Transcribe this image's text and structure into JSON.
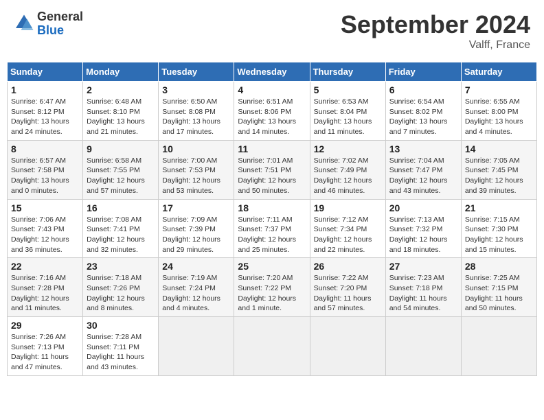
{
  "header": {
    "logo_general": "General",
    "logo_blue": "Blue",
    "month_title": "September 2024",
    "location": "Valff, France"
  },
  "weekdays": [
    "Sunday",
    "Monday",
    "Tuesday",
    "Wednesday",
    "Thursday",
    "Friday",
    "Saturday"
  ],
  "weeks": [
    [
      {
        "day": "1",
        "sunrise": "6:47 AM",
        "sunset": "8:12 PM",
        "daylight": "13 hours and 24 minutes."
      },
      {
        "day": "2",
        "sunrise": "6:48 AM",
        "sunset": "8:10 PM",
        "daylight": "13 hours and 21 minutes."
      },
      {
        "day": "3",
        "sunrise": "6:50 AM",
        "sunset": "8:08 PM",
        "daylight": "13 hours and 17 minutes."
      },
      {
        "day": "4",
        "sunrise": "6:51 AM",
        "sunset": "8:06 PM",
        "daylight": "13 hours and 14 minutes."
      },
      {
        "day": "5",
        "sunrise": "6:53 AM",
        "sunset": "8:04 PM",
        "daylight": "13 hours and 11 minutes."
      },
      {
        "day": "6",
        "sunrise": "6:54 AM",
        "sunset": "8:02 PM",
        "daylight": "13 hours and 7 minutes."
      },
      {
        "day": "7",
        "sunrise": "6:55 AM",
        "sunset": "8:00 PM",
        "daylight": "13 hours and 4 minutes."
      }
    ],
    [
      {
        "day": "8",
        "sunrise": "6:57 AM",
        "sunset": "7:58 PM",
        "daylight": "13 hours and 0 minutes."
      },
      {
        "day": "9",
        "sunrise": "6:58 AM",
        "sunset": "7:55 PM",
        "daylight": "12 hours and 57 minutes."
      },
      {
        "day": "10",
        "sunrise": "7:00 AM",
        "sunset": "7:53 PM",
        "daylight": "12 hours and 53 minutes."
      },
      {
        "day": "11",
        "sunrise": "7:01 AM",
        "sunset": "7:51 PM",
        "daylight": "12 hours and 50 minutes."
      },
      {
        "day": "12",
        "sunrise": "7:02 AM",
        "sunset": "7:49 PM",
        "daylight": "12 hours and 46 minutes."
      },
      {
        "day": "13",
        "sunrise": "7:04 AM",
        "sunset": "7:47 PM",
        "daylight": "12 hours and 43 minutes."
      },
      {
        "day": "14",
        "sunrise": "7:05 AM",
        "sunset": "7:45 PM",
        "daylight": "12 hours and 39 minutes."
      }
    ],
    [
      {
        "day": "15",
        "sunrise": "7:06 AM",
        "sunset": "7:43 PM",
        "daylight": "12 hours and 36 minutes."
      },
      {
        "day": "16",
        "sunrise": "7:08 AM",
        "sunset": "7:41 PM",
        "daylight": "12 hours and 32 minutes."
      },
      {
        "day": "17",
        "sunrise": "7:09 AM",
        "sunset": "7:39 PM",
        "daylight": "12 hours and 29 minutes."
      },
      {
        "day": "18",
        "sunrise": "7:11 AM",
        "sunset": "7:37 PM",
        "daylight": "12 hours and 25 minutes."
      },
      {
        "day": "19",
        "sunrise": "7:12 AM",
        "sunset": "7:34 PM",
        "daylight": "12 hours and 22 minutes."
      },
      {
        "day": "20",
        "sunrise": "7:13 AM",
        "sunset": "7:32 PM",
        "daylight": "12 hours and 18 minutes."
      },
      {
        "day": "21",
        "sunrise": "7:15 AM",
        "sunset": "7:30 PM",
        "daylight": "12 hours and 15 minutes."
      }
    ],
    [
      {
        "day": "22",
        "sunrise": "7:16 AM",
        "sunset": "7:28 PM",
        "daylight": "12 hours and 11 minutes."
      },
      {
        "day": "23",
        "sunrise": "7:18 AM",
        "sunset": "7:26 PM",
        "daylight": "12 hours and 8 minutes."
      },
      {
        "day": "24",
        "sunrise": "7:19 AM",
        "sunset": "7:24 PM",
        "daylight": "12 hours and 4 minutes."
      },
      {
        "day": "25",
        "sunrise": "7:20 AM",
        "sunset": "7:22 PM",
        "daylight": "12 hours and 1 minute."
      },
      {
        "day": "26",
        "sunrise": "7:22 AM",
        "sunset": "7:20 PM",
        "daylight": "11 hours and 57 minutes."
      },
      {
        "day": "27",
        "sunrise": "7:23 AM",
        "sunset": "7:18 PM",
        "daylight": "11 hours and 54 minutes."
      },
      {
        "day": "28",
        "sunrise": "7:25 AM",
        "sunset": "7:15 PM",
        "daylight": "11 hours and 50 minutes."
      }
    ],
    [
      {
        "day": "29",
        "sunrise": "7:26 AM",
        "sunset": "7:13 PM",
        "daylight": "11 hours and 47 minutes."
      },
      {
        "day": "30",
        "sunrise": "7:28 AM",
        "sunset": "7:11 PM",
        "daylight": "11 hours and 43 minutes."
      },
      null,
      null,
      null,
      null,
      null
    ]
  ],
  "labels": {
    "sunrise": "Sunrise:",
    "sunset": "Sunset:",
    "daylight": "Daylight:"
  }
}
